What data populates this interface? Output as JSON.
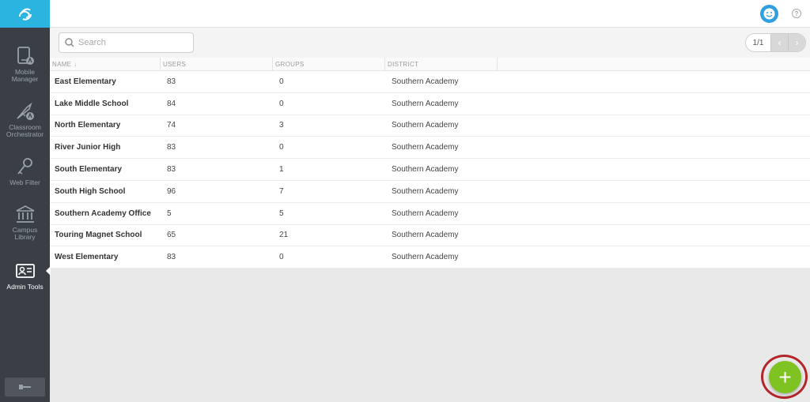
{
  "sidebar": {
    "items": [
      {
        "label_1": "Mobile",
        "label_2": "Manager",
        "icon": "tablet-icon"
      },
      {
        "label_1": "Classroom",
        "label_2": "Orchestrator",
        "icon": "wand-icon"
      },
      {
        "label_1": "Web Filter",
        "label_2": "",
        "icon": "key-icon"
      },
      {
        "label_1": "Campus",
        "label_2": "Library",
        "icon": "library-icon"
      },
      {
        "label_1": "Admin Tools",
        "label_2": "",
        "icon": "id-card-icon"
      }
    ],
    "active_index": 4
  },
  "toolbar": {
    "search_placeholder": "Search",
    "pager_text": "1/1"
  },
  "table": {
    "columns": [
      "NAME",
      "USERS",
      "GROUPS",
      "DISTRICT"
    ],
    "rows": [
      {
        "name": "East Elementary",
        "users": "83",
        "groups": "0",
        "district": "Southern Academy"
      },
      {
        "name": "Lake Middle School",
        "users": "84",
        "groups": "0",
        "district": "Southern Academy"
      },
      {
        "name": "North Elementary",
        "users": "74",
        "groups": "3",
        "district": "Southern Academy"
      },
      {
        "name": "River Junior High",
        "users": "83",
        "groups": "0",
        "district": "Southern Academy"
      },
      {
        "name": "South Elementary",
        "users": "83",
        "groups": "1",
        "district": "Southern Academy"
      },
      {
        "name": "South High School",
        "users": "96",
        "groups": "7",
        "district": "Southern Academy"
      },
      {
        "name": "Southern Academy Office",
        "users": "5",
        "groups": "5",
        "district": "Southern Academy"
      },
      {
        "name": "Touring Magnet School",
        "users": "65",
        "groups": "21",
        "district": "Southern Academy"
      },
      {
        "name": "West Elementary",
        "users": "83",
        "groups": "0",
        "district": "Southern Academy"
      }
    ]
  },
  "colors": {
    "brand": "#2bb4e0",
    "sidebar": "#3a3f45",
    "add_button": "#7ec322",
    "highlight_ring": "#b3262b"
  }
}
